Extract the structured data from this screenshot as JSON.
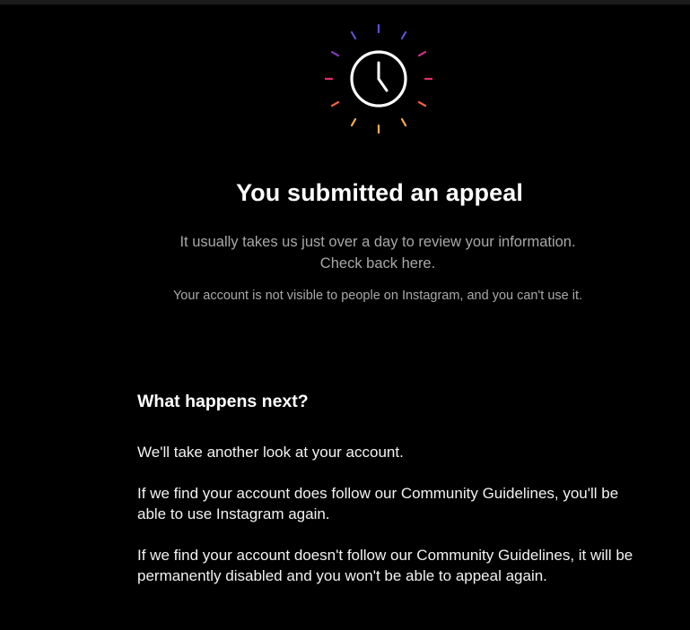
{
  "header": {
    "icon": "clock-icon",
    "title": "You submitted an appeal",
    "subtitle": "It usually takes us just over a day to review your information. Check back here.",
    "notice": "Your account is not visible to people on Instagram, and you can't use it."
  },
  "next_steps": {
    "heading": "What happens next?",
    "paragraphs": [
      "We'll take another look at your account.",
      "If we find your account does follow our Community Guidelines, you'll be able to use Instagram again.",
      "If we find your account doesn't follow our Community Guidelines, it will be permanently disabled and you won't be able to appeal again."
    ]
  },
  "colors": {
    "background": "#000000",
    "text_primary": "#ffffff",
    "text_secondary": "#a8a8a8",
    "ray_gradient": [
      "#5b51d8",
      "#833ab4",
      "#c13584",
      "#e1306c",
      "#fd1d1d",
      "#f56040",
      "#fcaf45"
    ]
  }
}
